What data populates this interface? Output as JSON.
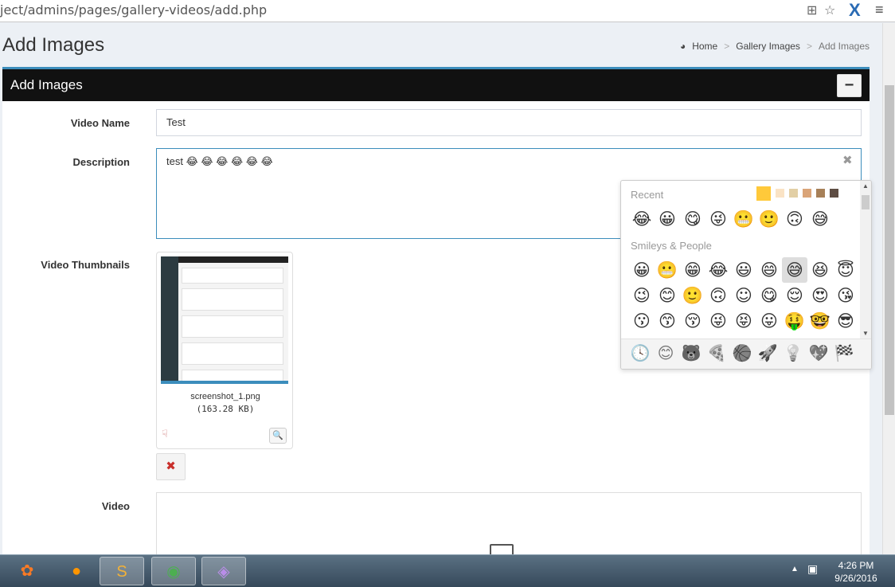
{
  "browser": {
    "url": "ject/admins/pages/gallery-videos/add.php",
    "icons": [
      "translate-icon",
      "star-icon",
      "x-brand-icon",
      "menu-icon"
    ]
  },
  "page": {
    "title": "Add Images",
    "breadcrumb": {
      "home": "Home",
      "section": "Gallery Images",
      "current": "Add Images"
    }
  },
  "box": {
    "title": "Add Images",
    "collapse_label": "−"
  },
  "form": {
    "video_name_label": "Video Name",
    "video_name_value": "Test",
    "description_label": "Description",
    "description_value": "test 😂 😂 😂 😂 😂 😂",
    "thumbnails_label": "Video Thumbnails",
    "thumbnail_file": "screenshot_1.png",
    "thumbnail_size": "(163.28 KB)",
    "video_label": "Video"
  },
  "emoji_picker": {
    "recent_label": "Recent",
    "smileys_label": "Smileys & People",
    "tones": [
      "#ffc93a",
      "#fae3c5",
      "#e2cfa5",
      "#daa478",
      "#a78058",
      "#5e4d43"
    ],
    "recent": [
      "😂",
      "😀",
      "😋",
      "😜",
      "😬",
      "🙂",
      "🙃",
      "😅"
    ],
    "smileys": [
      [
        "😀",
        "😬",
        "😁",
        "😂",
        "😃",
        "😄",
        "😅",
        "😆",
        "😇"
      ],
      [
        "😉",
        "😊",
        "🙂",
        "🙃",
        "☺",
        "😋",
        "😌",
        "😍",
        "😘"
      ],
      [
        "😗",
        "😙",
        "😚",
        "😜",
        "😝",
        "😛",
        "🤑",
        "🤓",
        "😎"
      ]
    ],
    "categories": [
      "🕓",
      "😊",
      "🐻",
      "🍕",
      "🏀",
      "🚀",
      "💡",
      "💖",
      "🏁"
    ]
  },
  "taskbar": {
    "apps": [
      "xampp",
      "firefox",
      "sublime-text",
      "chrome",
      "app"
    ],
    "time": "4:26 PM",
    "date": "9/26/2016"
  }
}
